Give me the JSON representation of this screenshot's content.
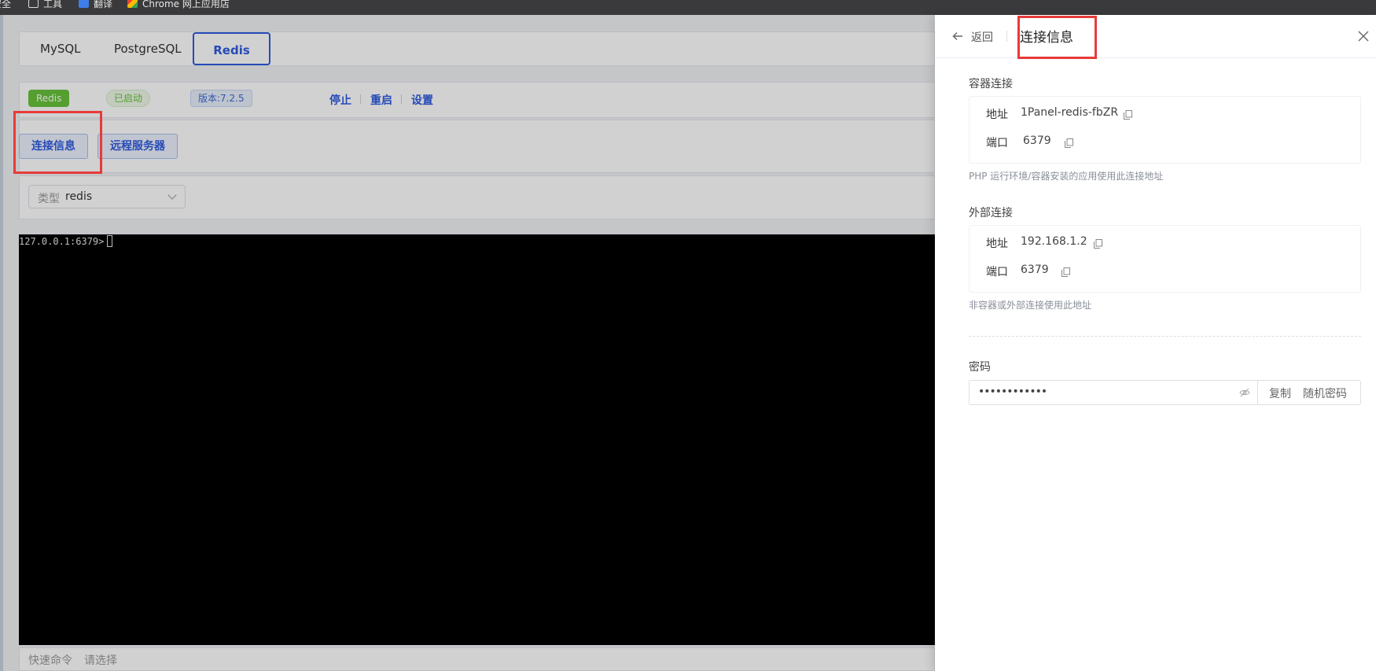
{
  "bookmarks": [
    {
      "label": "安全",
      "icon": "folder-icon"
    },
    {
      "label": "工具",
      "icon": "folder-icon"
    },
    {
      "label": "翻译",
      "icon": "translate-icon"
    },
    {
      "label": "Chrome 网上应用店",
      "icon": "chrome-store-icon"
    }
  ],
  "db_tabs": [
    "MySQL",
    "PostgreSQL",
    "Redis"
  ],
  "active_tab": "Redis",
  "status": {
    "app_tag": "Redis",
    "running_tag": "已启动",
    "version_tag": "版本:7.2.5",
    "actions": [
      "停止",
      "重启",
      "设置"
    ]
  },
  "buttons": {
    "conn_info": "连接信息",
    "remote_server": "远程服务器"
  },
  "type_select": {
    "label": "类型",
    "value": "redis"
  },
  "terminal": {
    "prompt": "127.0.0.1:6379>"
  },
  "quick_command": {
    "label": "快速命令",
    "placeholder": "请选择"
  },
  "drawer": {
    "back_label": "返回",
    "title": "连接信息",
    "container": {
      "title": "容器连接",
      "address_key": "地址",
      "address_value": "1Panel-redis-fbZR",
      "port_key": "端口",
      "port_value": "6379",
      "hint": "PHP 运行环境/容器安装的应用使用此连接地址"
    },
    "external": {
      "title": "外部连接",
      "address_key": "地址",
      "address_value": "192.168.1.2",
      "port_key": "端口",
      "port_value": "6379",
      "hint": "非容器或外部连接使用此地址"
    },
    "password": {
      "title": "密码",
      "masked_value": "••••••••••••",
      "copy_label": "复制",
      "random_label": "随机密码"
    }
  },
  "colors": {
    "accent": "#2f5ce0",
    "success": "#67c23a",
    "annotation": "#e83a3a"
  }
}
